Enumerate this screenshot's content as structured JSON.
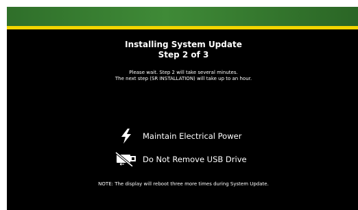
{
  "header": {
    "bar_color": "#3a7f33",
    "stripe_color": "#f3d500"
  },
  "main": {
    "title": "Installing System Update",
    "step": "Step 2 of 3",
    "info_line1": "Please wait. Step 2 will take several minutes.",
    "info_line2": "The next step (SR INSTALLATION) will take up to an hour."
  },
  "warnings": [
    {
      "icon": "lightning-bolt-icon",
      "label": "Maintain Electrical Power"
    },
    {
      "icon": "no-usb-drive-icon",
      "label": "Do Not Remove USB Drive"
    }
  ],
  "note": "NOTE: The display will reboot three more times during System Update."
}
